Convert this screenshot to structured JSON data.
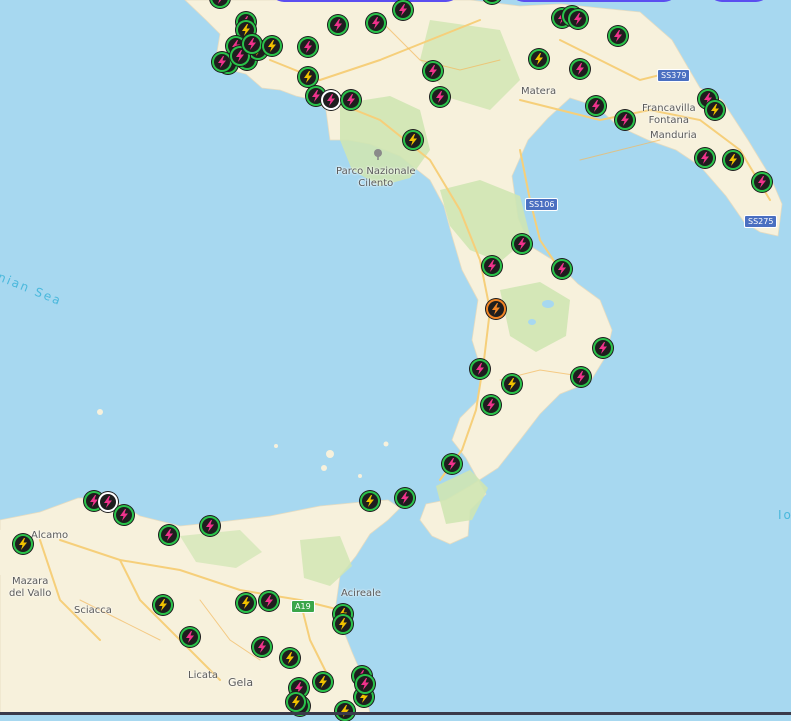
{
  "map": {
    "colors": {
      "sea": "#a7d8f0",
      "land": "#f7f1dc",
      "park": "#cfe6b2",
      "road": "#f6cf7a"
    },
    "sea_labels": [
      {
        "text": "nian Sea",
        "key": "tyrrhenian"
      },
      {
        "text": "Io",
        "key": "ionian"
      }
    ],
    "place_labels": {
      "matera": "Matera",
      "francavilla1": "Francavilla",
      "francavilla2": "Fontana",
      "manduria": "Manduria",
      "cilento1": "Parco Nazionale",
      "cilento2": "Cilento",
      "alcamo": "Alcamo",
      "mazara1": "Mazara",
      "mazara2": "del Vallo",
      "sciacca": "Sciacca",
      "acireale": "Acireale",
      "licata": "Licata",
      "gela": "Gela"
    },
    "road_shields": {
      "ss379": "SS379",
      "ss106": "SS106",
      "ss275": "SS275",
      "a19": "A19"
    },
    "icons": {
      "marker_fast": "lightning-bolt-pink",
      "marker_slow": "lightning-bolt-yellow",
      "marker_selected": "lightning-bolt-orange",
      "park": "tree-icon"
    },
    "stations": [
      {
        "id": 1,
        "type": "fast"
      },
      {
        "id": 2,
        "type": "fast"
      },
      {
        "id": 3,
        "type": "slow"
      },
      {
        "id": 4,
        "type": "fast"
      },
      {
        "id": 5,
        "type": "fast"
      },
      {
        "id": 6,
        "type": "fast"
      },
      {
        "id": 7,
        "type": "slow"
      },
      {
        "id": 8,
        "type": "fast"
      },
      {
        "id": 9,
        "type": "slow"
      },
      {
        "id": 10,
        "type": "fast"
      },
      {
        "id": 11,
        "type": "fast"
      },
      {
        "id": 12,
        "type": "slow"
      },
      {
        "id": 13,
        "type": "fast"
      },
      {
        "id": 14,
        "type": "fast"
      },
      {
        "id": 15,
        "type": "fast"
      },
      {
        "id": 16,
        "type": "fast"
      },
      {
        "id": 17,
        "type": "slow"
      },
      {
        "id": 18,
        "type": "fast"
      },
      {
        "id": 19,
        "type": "fast"
      },
      {
        "id": 20,
        "type": "fast"
      },
      {
        "id": 21,
        "type": "fast"
      },
      {
        "id": 22,
        "type": "fast"
      },
      {
        "id": 23,
        "type": "slow"
      },
      {
        "id": 24,
        "type": "fast"
      },
      {
        "id": 25,
        "type": "fast"
      },
      {
        "id": 26,
        "type": "fast"
      },
      {
        "id": 27,
        "type": "fast"
      },
      {
        "id": 28,
        "type": "fast"
      },
      {
        "id": 29,
        "type": "fast"
      },
      {
        "id": 30,
        "type": "slow"
      },
      {
        "id": 31,
        "type": "fast"
      },
      {
        "id": 32,
        "type": "fast"
      },
      {
        "id": 33,
        "type": "fast"
      },
      {
        "id": 34,
        "type": "slow"
      },
      {
        "id": 35,
        "type": "fast"
      },
      {
        "id": 36,
        "type": "selected"
      },
      {
        "id": 37,
        "type": "fast"
      },
      {
        "id": 38,
        "type": "fast"
      },
      {
        "id": 39,
        "type": "slow"
      },
      {
        "id": 40,
        "type": "fast"
      },
      {
        "id": 41,
        "type": "fast"
      },
      {
        "id": 42,
        "type": "fast"
      },
      {
        "id": 43,
        "type": "fast"
      },
      {
        "id": 44,
        "type": "fast"
      },
      {
        "id": 45,
        "type": "slow"
      },
      {
        "id": 46,
        "type": "fast"
      },
      {
        "id": 47,
        "type": "fast"
      },
      {
        "id": 48,
        "type": "fast"
      },
      {
        "id": 49,
        "type": "fast"
      },
      {
        "id": 50,
        "type": "slow"
      },
      {
        "id": 51,
        "type": "fast"
      },
      {
        "id": 52,
        "type": "fast"
      },
      {
        "id": 53,
        "type": "slow"
      },
      {
        "id": 54,
        "type": "slow"
      },
      {
        "id": 55,
        "type": "fast"
      },
      {
        "id": 56,
        "type": "fast"
      },
      {
        "id": 57,
        "type": "slow"
      },
      {
        "id": 58,
        "type": "slow"
      },
      {
        "id": 59,
        "type": "fast"
      },
      {
        "id": 60,
        "type": "slow"
      },
      {
        "id": 61,
        "type": "fast"
      },
      {
        "id": 62,
        "type": "slow"
      },
      {
        "id": 63,
        "type": "slow"
      },
      {
        "id": 64,
        "type": "slow"
      },
      {
        "id": 65,
        "type": "fast"
      },
      {
        "id": 66,
        "type": "slow"
      },
      {
        "id": 67,
        "type": "fast"
      },
      {
        "id": 68,
        "type": "slow"
      },
      {
        "id": 69,
        "type": "fast"
      },
      {
        "id": 70,
        "type": "slow"
      },
      {
        "id": 71,
        "type": "fast"
      }
    ]
  }
}
